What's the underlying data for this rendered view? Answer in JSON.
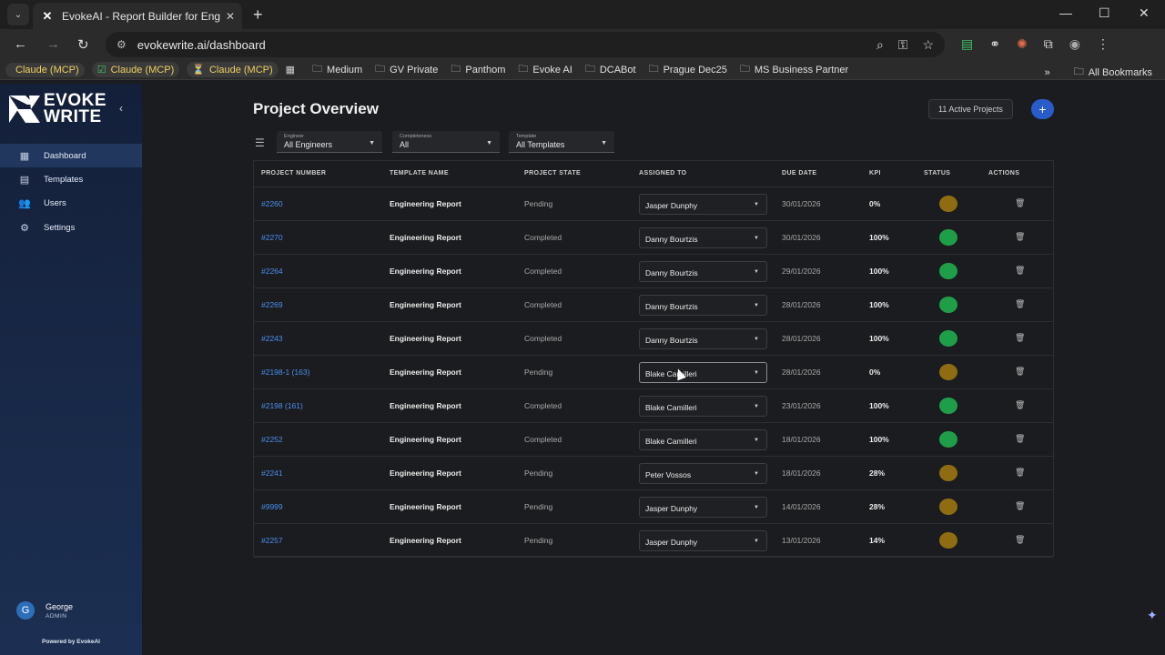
{
  "browser": {
    "tab_title": "EvokeAI - Report Builder for Engineers",
    "url": "evokewrite.ai/dashboard",
    "bookmarks": [
      {
        "label": "Claude (MCP)",
        "icon": "",
        "type": "pill"
      },
      {
        "label": "Claude (MCP)",
        "icon": "☑",
        "type": "pill"
      },
      {
        "label": "Claude (MCP)",
        "icon": "⏳",
        "type": "pill"
      },
      {
        "label": "",
        "icon": "grid-icon",
        "type": "apps"
      },
      {
        "label": "Medium",
        "icon": "folder-icon",
        "type": "folder"
      },
      {
        "label": "GV Private",
        "icon": "folder-icon",
        "type": "folder"
      },
      {
        "label": "Panthom",
        "icon": "folder-icon",
        "type": "folder"
      },
      {
        "label": "Evoke AI",
        "icon": "folder-icon",
        "type": "folder"
      },
      {
        "label": "DCABot",
        "icon": "folder-icon",
        "type": "folder"
      },
      {
        "label": "Prague Dec25",
        "icon": "folder-icon",
        "type": "folder"
      },
      {
        "label": "MS Business Partner",
        "icon": "folder-icon",
        "type": "folder"
      }
    ],
    "all_bookmarks": "All Bookmarks"
  },
  "sidebar": {
    "logo_line1": "EVOKE",
    "logo_line2": "WRITE",
    "items": [
      {
        "label": "Dashboard",
        "icon": "dashboard-icon",
        "active": true
      },
      {
        "label": "Templates",
        "icon": "document-icon",
        "active": false
      },
      {
        "label": "Users",
        "icon": "users-icon",
        "active": false
      },
      {
        "label": "Settings",
        "icon": "gear-icon",
        "active": false
      }
    ],
    "user": {
      "initial": "G",
      "name": "George",
      "role": "ADMIN"
    },
    "powered_by": "Powered by EvokeAI"
  },
  "header": {
    "title": "Project Overview",
    "active_projects": "11 Active Projects",
    "add_label": "+"
  },
  "filters": [
    {
      "label": "Engineer",
      "value": "All Engineers"
    },
    {
      "label": "Completeness",
      "value": "All"
    },
    {
      "label": "Template",
      "value": "All Templates"
    }
  ],
  "table": {
    "columns": [
      "PROJECT NUMBER",
      "TEMPLATE NAME",
      "PROJECT STATE",
      "ASSIGNED TO",
      "DUE DATE",
      "KPI",
      "STATUS",
      "ACTIONS"
    ],
    "rows": [
      {
        "number": "#2260",
        "template": "Engineering Report",
        "state": "Pending",
        "assigned": "Jasper Dunphy",
        "due": "30/01/2026",
        "kpi": "0%",
        "status_color": "#8f6c12"
      },
      {
        "number": "#2270",
        "template": "Engineering Report",
        "state": "Completed",
        "assigned": "Danny Bourtzis",
        "due": "30/01/2026",
        "kpi": "100%",
        "status_color": "#1f9e4a"
      },
      {
        "number": "#2264",
        "template": "Engineering Report",
        "state": "Completed",
        "assigned": "Danny Bourtzis",
        "due": "29/01/2026",
        "kpi": "100%",
        "status_color": "#1f9e4a"
      },
      {
        "number": "#2269",
        "template": "Engineering Report",
        "state": "Completed",
        "assigned": "Danny Bourtzis",
        "due": "28/01/2026",
        "kpi": "100%",
        "status_color": "#1f9e4a"
      },
      {
        "number": "#2243",
        "template": "Engineering Report",
        "state": "Completed",
        "assigned": "Danny Bourtzis",
        "due": "28/01/2026",
        "kpi": "100%",
        "status_color": "#1f9e4a"
      },
      {
        "number": "#2198-1 (163)",
        "template": "Engineering Report",
        "state": "Pending",
        "assigned": "Blake Camilleri",
        "due": "28/01/2026",
        "kpi": "0%",
        "status_color": "#8f6c12",
        "focused": true
      },
      {
        "number": "#2198 (161)",
        "template": "Engineering Report",
        "state": "Completed",
        "assigned": "Blake Camilleri",
        "due": "23/01/2026",
        "kpi": "100%",
        "status_color": "#1f9e4a"
      },
      {
        "number": "#2252",
        "template": "Engineering Report",
        "state": "Completed",
        "assigned": "Blake Camilleri",
        "due": "18/01/2026",
        "kpi": "100%",
        "status_color": "#1f9e4a"
      },
      {
        "number": "#2241",
        "template": "Engineering Report",
        "state": "Pending",
        "assigned": "Peter Vossos",
        "due": "18/01/2026",
        "kpi": "28%",
        "status_color": "#8f6c12"
      },
      {
        "number": "#9999",
        "template": "Engineering Report",
        "state": "Pending",
        "assigned": "Jasper Dunphy",
        "due": "14/01/2026",
        "kpi": "28%",
        "status_color": "#8f6c12"
      },
      {
        "number": "#2257",
        "template": "Engineering Report",
        "state": "Pending",
        "assigned": "Jasper Dunphy",
        "due": "13/01/2026",
        "kpi": "14%",
        "status_color": "#8f6c12"
      }
    ]
  }
}
